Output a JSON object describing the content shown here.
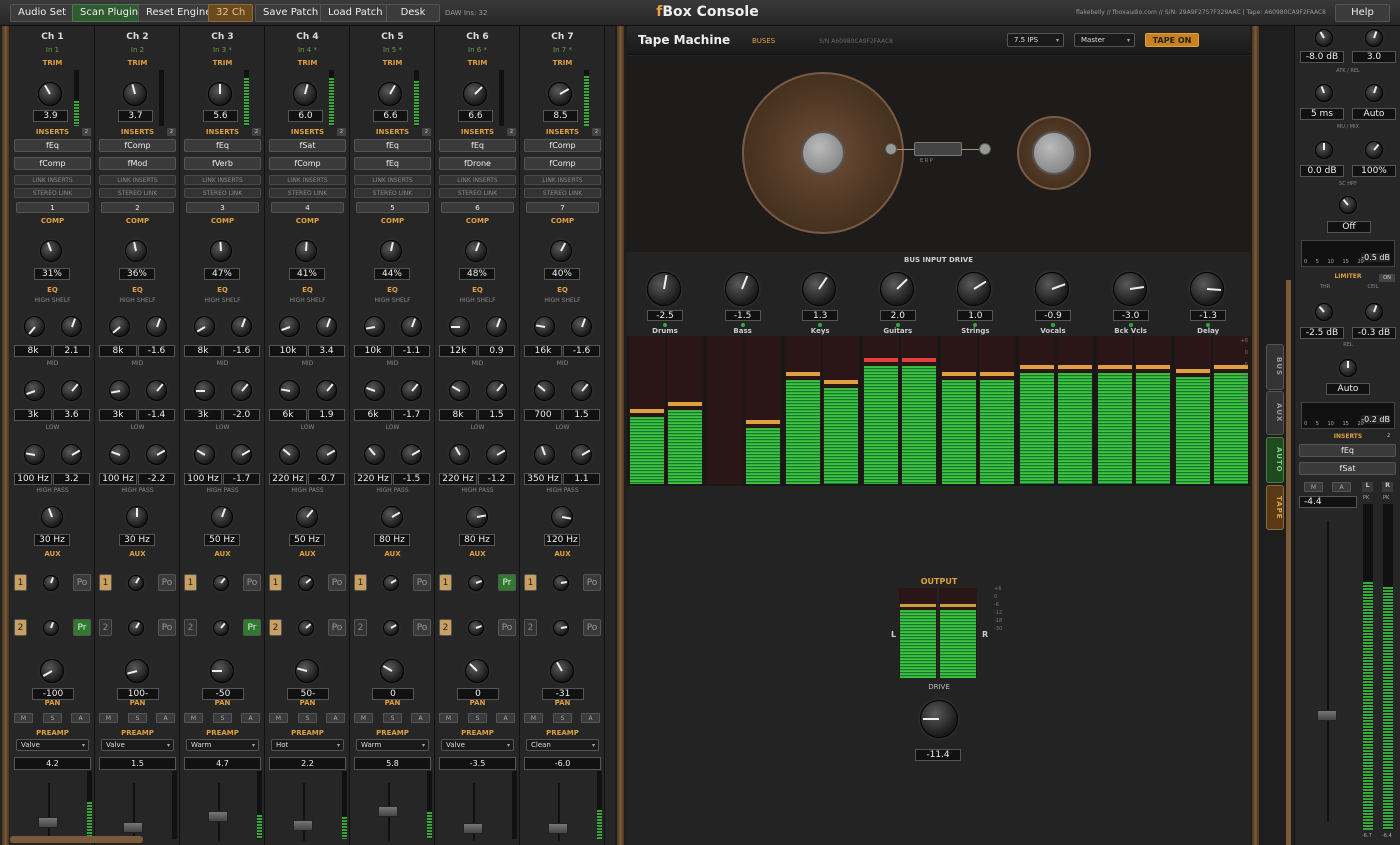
{
  "topbar": {
    "buttons": [
      "Audio Set",
      "Scan Plugins",
      "Reset Engine",
      "32 Ch",
      "Save Patch",
      "Load Patch",
      "Desk"
    ],
    "daw": "DAW Ins: 32",
    "title_f": "f",
    "title_rest": "Box Console",
    "serial": "flakebelly  //  fboxaudio.com  //  S/N: 29A9F2757F329AAC  |  Tape: A60980CA9F2FAAC8",
    "help": "Help"
  },
  "labels": {
    "trim": "TRIM",
    "inserts": "INSERTS",
    "link_inserts": "LINK INSERTS",
    "stereo_link": "STEREO LINK",
    "comp": "COMP",
    "eq": "EQ",
    "high_shelf": "HIGH SHELF",
    "mid": "MID",
    "low": "LOW",
    "high_pass": "HIGH PASS",
    "aux": "AUX",
    "pan": "PAN",
    "preamp": "PREAMP",
    "m": "M",
    "s": "S",
    "a": "A",
    "po": "Po",
    "pr": "Pr",
    "aux1": "1",
    "aux2": "2",
    "insert_count": "2"
  },
  "channels": [
    {
      "name": "Ch 1",
      "input": "In 1",
      "trim": "3.9",
      "trim_level": 0.45,
      "ins1": "fEq",
      "ins2": "fComp",
      "num": "1",
      "comp": "31%",
      "hs_f": "8k",
      "hs_g": "2.1",
      "mid_f": "3k",
      "mid_g": "3.6",
      "low_f": "100 Hz",
      "low_g": "3.2",
      "hp": "30 Hz",
      "aux1_on": true,
      "aux1_pre": false,
      "aux2_on": true,
      "aux2_pre": true,
      "pan": "-100",
      "preamp": "Valve",
      "pre_val": "4.2",
      "fader": 0.1,
      "out_meter": 0.9
    },
    {
      "name": "Ch 2",
      "input": "In 2",
      "trim": "3.7",
      "trim_level": 0.0,
      "ins1": "fComp",
      "ins2": "fMod",
      "num": "2",
      "comp": "36%",
      "hs_f": "8k",
      "hs_g": "-1.6",
      "mid_f": "3k",
      "mid_g": "-1.4",
      "low_f": "100 Hz",
      "low_g": "-2.2",
      "hp": "30 Hz",
      "aux1_on": true,
      "aux1_pre": false,
      "aux2_on": false,
      "aux2_pre": false,
      "pan": "100-",
      "preamp": "Valve",
      "pre_val": "1.5",
      "fader": 0.02,
      "out_meter": 0.0
    },
    {
      "name": "Ch 3",
      "input": "In 3 *",
      "trim": "5.6",
      "trim_level": 0.85,
      "ins1": "fEq",
      "ins2": "fVerb",
      "num": "3",
      "comp": "47%",
      "hs_f": "8k",
      "hs_g": "-1.6",
      "mid_f": "3k",
      "mid_g": "-2.0",
      "low_f": "100 Hz",
      "low_g": "-1.7",
      "hp": "50 Hz",
      "aux1_on": true,
      "aux1_pre": false,
      "aux2_on": false,
      "aux2_pre": true,
      "pan": "-50",
      "preamp": "Warm",
      "pre_val": "4.7",
      "fader": 0.2,
      "out_meter": 0.6
    },
    {
      "name": "Ch 4",
      "input": "In 4 *",
      "trim": "6.0",
      "trim_level": 0.85,
      "ins1": "fSat",
      "ins2": "fComp",
      "num": "4",
      "comp": "41%",
      "hs_f": "10k",
      "hs_g": "3.4",
      "mid_f": "6k",
      "mid_g": "1.9",
      "low_f": "220 Hz",
      "low_g": "-0.7",
      "hp": "50 Hz",
      "aux1_on": true,
      "aux1_pre": false,
      "aux2_on": true,
      "aux2_pre": false,
      "pan": "50-",
      "preamp": "Hot",
      "pre_val": "2.2",
      "fader": 0.05,
      "out_meter": 0.55
    },
    {
      "name": "Ch 5",
      "input": "In 5 *",
      "trim": "6.6",
      "trim_level": 0.8,
      "ins1": "fEq",
      "ins2": "fEq",
      "num": "5",
      "comp": "44%",
      "hs_f": "10k",
      "hs_g": "-1.1",
      "mid_f": "6k",
      "mid_g": "-1.7",
      "low_f": "220 Hz",
      "low_g": "-1.5",
      "hp": "80 Hz",
      "aux1_on": true,
      "aux1_pre": false,
      "aux2_on": false,
      "aux2_pre": false,
      "pan": "0",
      "preamp": "Warm",
      "pre_val": "5.8",
      "fader": 0.3,
      "out_meter": 0.65
    },
    {
      "name": "Ch 6",
      "input": "In 6 *",
      "trim": "6.6",
      "trim_level": 0.0,
      "ins1": "fEq",
      "ins2": "fDrone",
      "num": "6",
      "comp": "48%",
      "hs_f": "12k",
      "hs_g": "0.9",
      "mid_f": "8k",
      "mid_g": "1.5",
      "low_f": "220 Hz",
      "low_g": "-1.2",
      "hp": "80 Hz",
      "aux1_on": true,
      "aux1_pre": true,
      "aux2_on": true,
      "aux2_pre": false,
      "pan": "0",
      "preamp": "Valve",
      "pre_val": "-3.5",
      "fader": 0.0,
      "out_meter": 0.0
    },
    {
      "name": "Ch 7",
      "input": "In 7 *",
      "trim": "8.5",
      "trim_level": 0.9,
      "ins1": "fComp",
      "ins2": "fComp",
      "num": "7",
      "comp": "40%",
      "hs_f": "16k",
      "hs_g": "-1.6",
      "mid_f": "700",
      "mid_g": "1.5",
      "low_f": "350 Hz",
      "low_g": "1.1",
      "hp": "120 Hz",
      "aux1_on": true,
      "aux1_pre": false,
      "aux2_on": false,
      "aux2_pre": false,
      "pan": "-31",
      "preamp": "Clean",
      "pre_val": "-6.0",
      "fader": 0.0,
      "out_meter": 0.7
    }
  ],
  "tape": {
    "title": "Tape Machine",
    "buses_tab": "BUSES",
    "serial": "S/N A60980CA9F2FAAC8",
    "speed": "7.5 IPS",
    "routing": "Master",
    "tape_on": "TAPE ON",
    "head_letters": "E  R  P",
    "bus_input_drive": "BUS INPUT DRIVE",
    "buses": [
      {
        "name": "Drums",
        "val": "-2.5"
      },
      {
        "name": "Bass",
        "val": "-1.5"
      },
      {
        "name": "Keys",
        "val": "1.3"
      },
      {
        "name": "Guitars",
        "val": "2.0"
      },
      {
        "name": "Strings",
        "val": "1.0"
      },
      {
        "name": "Vocals",
        "val": "-0.9"
      },
      {
        "name": "Bck Vcls",
        "val": "-3.0"
      },
      {
        "name": "Delay",
        "val": "-1.3"
      }
    ],
    "bus_levels": [
      [
        0.45,
        0.5
      ],
      [
        0.0,
        0.38
      ],
      [
        0.7,
        0.65
      ],
      [
        0.8,
        0.8
      ],
      [
        0.7,
        0.7
      ],
      [
        0.75,
        0.75
      ],
      [
        0.75,
        0.75
      ],
      [
        0.72,
        0.75
      ]
    ],
    "output": "OUTPUT",
    "drive": "DRIVE",
    "drive_val": "-11.4",
    "out_l": "L",
    "out_r": "R",
    "out_levels": [
      0.76,
      0.76
    ],
    "out_scale": [
      "+6",
      "0",
      "-6",
      "-12",
      "-18",
      "-30"
    ],
    "bus_scale": [
      "+6",
      "0",
      "-6",
      "-12",
      "-18",
      "-30"
    ]
  },
  "tabs": [
    "BUS",
    "AUX",
    "AUTO",
    "TAPE"
  ],
  "master": {
    "atk": "-8.0 dB",
    "rel_top": "3.0",
    "atk_rel": "ATK / REL",
    "ms": "5 ms",
    "auto": "Auto",
    "mu_mix": "MU / MIX",
    "mu": "0.0 dB",
    "mix": "100%",
    "sc_hpf": "SC HPF",
    "off": "Off",
    "meter1": "-0.5 dB",
    "limiter": "LIMITER",
    "lim_on": "ON",
    "thr": "THR",
    "ceil_label": "CEIL",
    "thr_val": "-2.5 dB",
    "ceil_val": "-0.3 dB",
    "rel": "REL",
    "rel_val": "Auto",
    "meter2": "-0.2 dB",
    "meter_scale": "0 5 10 15 20",
    "inserts": "INSERTS",
    "ins_count": "2",
    "ins1": "fEq",
    "ins2": "fSat",
    "m": "M",
    "a": "A",
    "l": "L",
    "r": "R",
    "pk": "PK",
    "fader_val": "-4.4",
    "peak_l": "-6.7",
    "peak_r": "-6.4",
    "level_l": 0.95,
    "level_r": 0.93
  }
}
